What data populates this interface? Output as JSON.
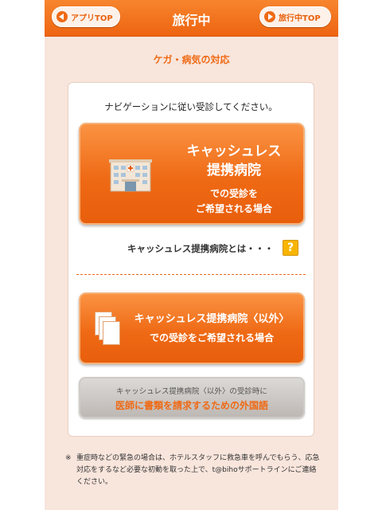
{
  "header": {
    "title": "旅行中",
    "back_label": "アプリTOP",
    "travel_top_label": "旅行中TOP"
  },
  "subtitle": "ケガ・病気の対応",
  "card": {
    "instruction": "ナビゲーションに従い受診してください。",
    "cashless_button": {
      "title_line1": "キャッシュレス",
      "title_line2": "提携病院",
      "sub_line1": "での受診を",
      "sub_line2": "ご希望される場合",
      "icon": "hospital-building-icon"
    },
    "what_is_label": "キャッシュレス提携病院とは・・・",
    "help_icon": "?",
    "other_button": {
      "title": "キャッシュレス提携病院〈以外〉",
      "sub": "での受診をご希望される場合",
      "icon": "documents-icon"
    },
    "phrase_button": {
      "line1": "キャッシュレス提携病院〈以外〉の受診時に",
      "line2": "医師に書類を請求するための外国語"
    }
  },
  "note": {
    "mark": "※",
    "text": "重症時などの緊急の場合は、ホテルスタッフに救急車を呼んでもらう、応急対応をするなど必要な初動を取った上で、t@bihoサポートラインにご連絡ください。"
  },
  "colors": {
    "accent": "#ef6a15",
    "background": "#f8e5dc",
    "help_icon": "#f7b500"
  }
}
